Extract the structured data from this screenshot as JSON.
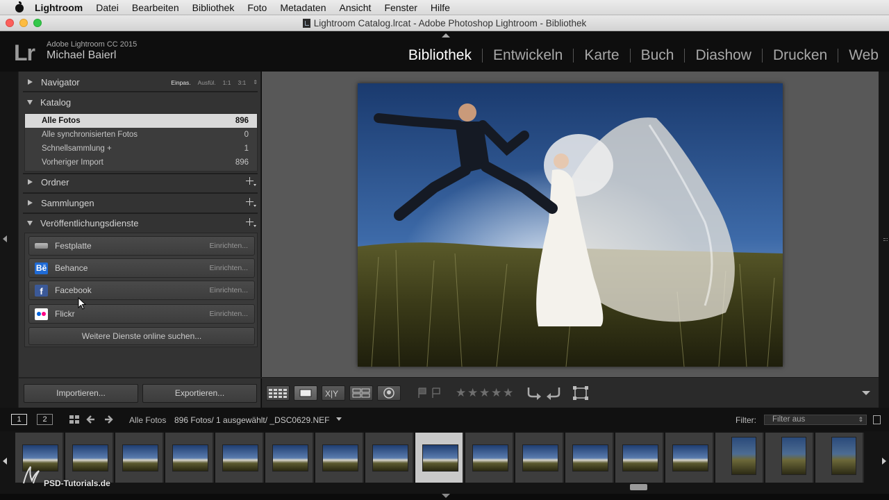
{
  "menubar": {
    "app": "Lightroom",
    "items": [
      "Datei",
      "Bearbeiten",
      "Bibliothek",
      "Foto",
      "Metadaten",
      "Ansicht",
      "Fenster",
      "Hilfe"
    ]
  },
  "window": {
    "title": "Lightroom Catalog.lrcat - Adobe Photoshop Lightroom - Bibliothek"
  },
  "identity": {
    "logo": "Lr",
    "version": "Adobe Lightroom CC 2015",
    "user": "Michael Baierl"
  },
  "modules": [
    "Bibliothek",
    "Entwickeln",
    "Karte",
    "Buch",
    "Diashow",
    "Drucken",
    "Web"
  ],
  "active_module": "Bibliothek",
  "navigator": {
    "title": "Navigator",
    "options": [
      "Einpas.",
      "Ausfül.",
      "1:1",
      "3:1"
    ]
  },
  "catalog": {
    "title": "Katalog",
    "items": [
      {
        "label": "Alle Fotos",
        "count": "896"
      },
      {
        "label": "Alle synchronisierten Fotos",
        "count": "0"
      },
      {
        "label": "Schnellsammlung +",
        "count": "1"
      },
      {
        "label": "Vorheriger Import",
        "count": "896"
      }
    ]
  },
  "folders": {
    "title": "Ordner"
  },
  "collections": {
    "title": "Sammlungen"
  },
  "publish": {
    "title": "Veröffentlichungsdienste",
    "services": [
      {
        "name": "Festplatte",
        "action": "Einrichten...",
        "icon": "hard-drive-icon"
      },
      {
        "name": "Behance",
        "action": "Einrichten...",
        "icon": "behance-icon",
        "glyph": "Bē"
      },
      {
        "name": "Facebook",
        "action": "Einrichten...",
        "icon": "facebook-icon",
        "glyph": "f"
      },
      {
        "name": "Flickr",
        "action": "Einrichten...",
        "icon": "flickr-icon"
      }
    ],
    "more": "Weitere Dienste online suchen..."
  },
  "footer": {
    "import": "Importieren...",
    "export": "Exportieren..."
  },
  "secondary": {
    "pages": [
      "1",
      "2"
    ],
    "source": "Alle Fotos",
    "info": "896 Fotos/ 1 ausgewählt/ _DSC0629.NEF",
    "filter_label": "Filter:",
    "filter_value": "Filter aus"
  },
  "watermark": "PSD-Tutorials.de",
  "colors": {
    "panel": "#333333",
    "accent_text": "#ffffff",
    "selection": "#d9d9d9"
  }
}
